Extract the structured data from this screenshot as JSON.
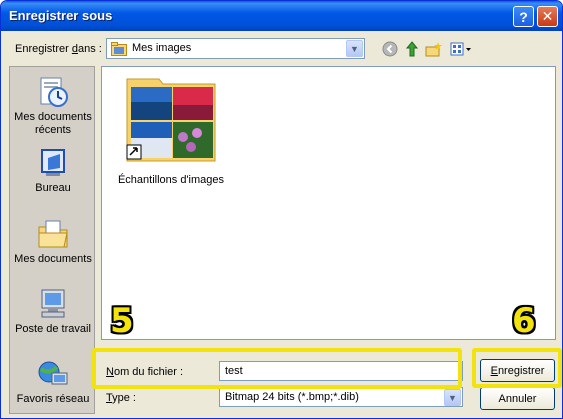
{
  "window": {
    "title": "Enregistrer sous"
  },
  "toolbar": {
    "save_in_label_prefix": "Enregistrer ",
    "save_in_label_hotkey": "d",
    "save_in_label_suffix": "ans :",
    "save_in_value": "Mes images"
  },
  "places": [
    {
      "label": "Mes documents récents",
      "icon": "recent-documents-icon"
    },
    {
      "label": "Bureau",
      "icon": "desktop-icon"
    },
    {
      "label": "Mes documents",
      "icon": "my-documents-icon"
    },
    {
      "label": "Poste de travail",
      "icon": "my-computer-icon"
    },
    {
      "label": "Favoris réseau",
      "icon": "network-places-icon"
    }
  ],
  "files": [
    {
      "name": "Échantillons d'images",
      "icon": "sample-pictures-folder-icon"
    }
  ],
  "filename": {
    "label_hotkey": "N",
    "label_rest": "om du fichier :",
    "value": "test"
  },
  "filetype": {
    "label_hotkey": "T",
    "label_rest": "ype :",
    "value": "Bitmap 24 bits (*.bmp;*.dib)"
  },
  "buttons": {
    "save_hotkey": "E",
    "save_rest": "nregistrer",
    "cancel": "Annuler"
  },
  "annotations": {
    "step5": "5",
    "step6": "6"
  },
  "colors": {
    "titlebar": "#0054e3",
    "highlight": "#f2e20d",
    "dialog_bg": "#ece9d8"
  }
}
